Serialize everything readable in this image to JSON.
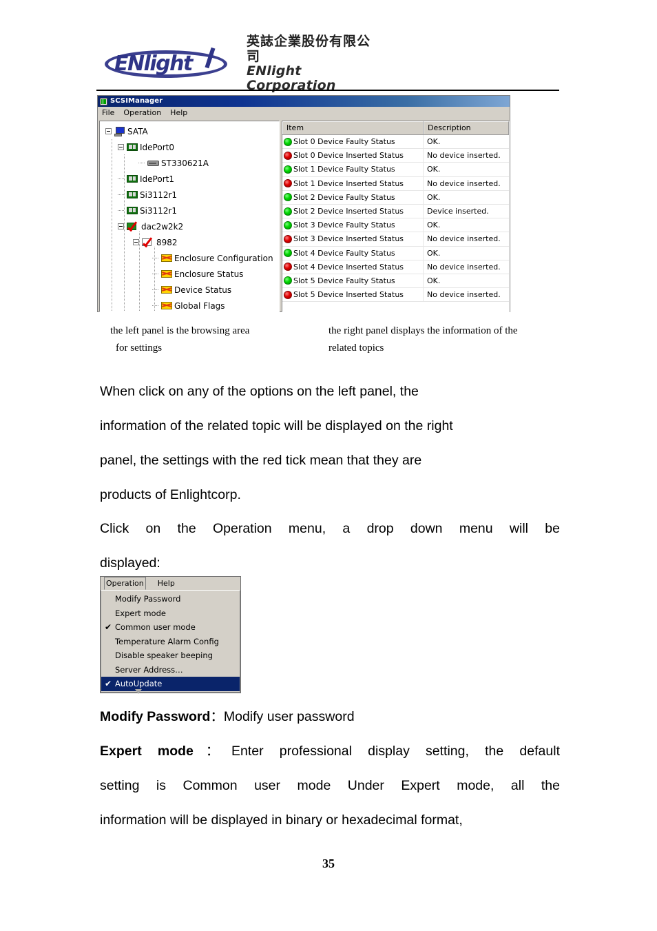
{
  "header": {
    "logo_word": "ENlight",
    "company_cn": "英誌企業股份有限公司",
    "company_en": "ENlight Corporation"
  },
  "app_window": {
    "title": "SCSIManager",
    "title_icon": "app-icon",
    "menus": [
      "File",
      "Operation",
      "Help"
    ],
    "tree": [
      {
        "label": "SATA",
        "icon": "computer-icon",
        "depth": 0,
        "expander": "minus"
      },
      {
        "label": "IdePort0",
        "icon": "card-icon",
        "depth": 1,
        "expander": "minus"
      },
      {
        "label": "ST330621A",
        "icon": "drive-icon",
        "depth": 2,
        "expander": "none"
      },
      {
        "label": "IdePort1",
        "icon": "card-icon",
        "depth": 1,
        "expander": "none"
      },
      {
        "label": "Si3112r1",
        "icon": "card-icon",
        "depth": 1,
        "expander": "none"
      },
      {
        "label": "Si3112r1",
        "icon": "card-icon",
        "depth": 1,
        "expander": "none"
      },
      {
        "label": "dac2w2k2",
        "icon": "red-tick-icon",
        "depth": 1,
        "expander": "minus"
      },
      {
        "label": "8982",
        "icon": "red-tick-icon",
        "depth": 2,
        "expander": "minus"
      },
      {
        "label": "Enclosure Configuration",
        "icon": "flag-icon",
        "depth": 3,
        "expander": "none"
      },
      {
        "label": "Enclosure Status",
        "icon": "flag-icon",
        "depth": 3,
        "expander": "none"
      },
      {
        "label": "Device  Status",
        "icon": "flag-icon",
        "depth": 3,
        "expander": "none"
      },
      {
        "label": "Global Flags",
        "icon": "flag-icon",
        "depth": 3,
        "expander": "none"
      }
    ],
    "list": {
      "columns": [
        "Item",
        "Description"
      ],
      "rows": [
        {
          "led": "green",
          "item": "Slot 0 Device Faulty Status",
          "desc": "OK."
        },
        {
          "led": "red",
          "item": "Slot 0 Device Inserted Status",
          "desc": "No device inserted."
        },
        {
          "led": "green",
          "item": "Slot 1 Device Faulty Status",
          "desc": "OK."
        },
        {
          "led": "red",
          "item": "Slot 1 Device Inserted Status",
          "desc": "No device inserted."
        },
        {
          "led": "green",
          "item": "Slot 2 Device Faulty Status",
          "desc": "OK."
        },
        {
          "led": "green",
          "item": "Slot 2 Device Inserted Status",
          "desc": "Device inserted."
        },
        {
          "led": "green",
          "item": "Slot 3 Device Faulty Status",
          "desc": "OK."
        },
        {
          "led": "red",
          "item": "Slot 3 Device Inserted Status",
          "desc": "No device inserted."
        },
        {
          "led": "green",
          "item": "Slot 4 Device Faulty Status",
          "desc": "OK."
        },
        {
          "led": "red",
          "item": "Slot 4 Device Inserted Status",
          "desc": "No device inserted."
        },
        {
          "led": "green",
          "item": "Slot 5 Device Faulty Status",
          "desc": "OK."
        },
        {
          "led": "red",
          "item": "Slot 5 Device Inserted Status",
          "desc": "No device inserted."
        }
      ]
    }
  },
  "captions": {
    "left_line1": "the left panel is the browsing area",
    "left_line2": "for settings",
    "right_line1": "the right panel displays the information of the",
    "right_line2": "related   topics"
  },
  "body": {
    "p1_line1": "When click on any of the options on the left panel, the",
    "p1_line2": "information of the related topic will be displayed on the right",
    "p1_line3": "panel, the settings with the red tick mean that they are",
    "p1_line4": "products of Enlightcorp.",
    "p2_line1": "Click on the Operation menu, a drop down menu will be",
    "p2_line2": "displayed:",
    "p3_term": "Modify Password",
    "p3_rest": "：Modify user password",
    "p4_term": "Expert mode",
    "p4_line1_rest": "：Enter professional display setting, the default",
    "p4_line2": "setting is Common user mode Under Expert mode, all the",
    "p4_line3": "information will be displayed in binary or hexadecimal format,"
  },
  "menu_shot": {
    "menubar": [
      "Operation",
      "Help"
    ],
    "items": [
      {
        "label": "Modify Password",
        "check": "",
        "selected": false
      },
      {
        "label": "Expert mode",
        "check": "",
        "selected": false
      },
      {
        "label": "Common user mode",
        "check": "✔",
        "selected": false
      },
      {
        "label": "Temperature Alarm Config",
        "check": "",
        "selected": false
      },
      {
        "label": "Disable speaker beeping",
        "check": "",
        "selected": false
      },
      {
        "label": "Server Address…",
        "check": "",
        "selected": false
      },
      {
        "label": "AutoUpdate",
        "check": "✔",
        "selected": true
      }
    ]
  },
  "footer": {
    "page_number": "35"
  }
}
